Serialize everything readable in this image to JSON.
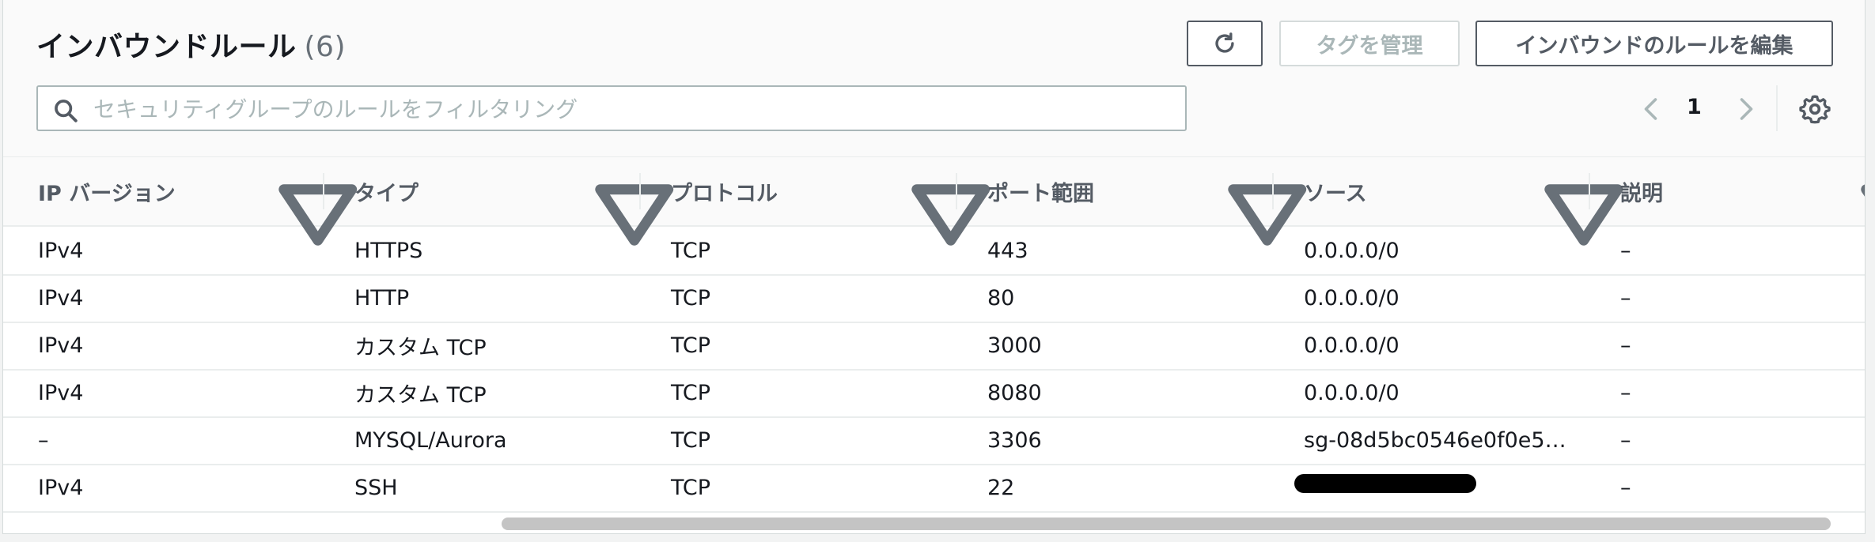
{
  "header": {
    "title": "インバウンドルール",
    "count": "(6)",
    "buttons": {
      "manage_tags": "タグを管理",
      "edit_inbound": "インバウンドのルールを編集"
    }
  },
  "search": {
    "placeholder": "セキュリティグループのルールをフィルタリング"
  },
  "pagination": {
    "page": "1"
  },
  "table": {
    "columns": [
      "IP バージョン",
      "タイプ",
      "プロトコル",
      "ポート範囲",
      "ソース",
      "説明"
    ],
    "rows": [
      [
        "IPv4",
        "HTTPS",
        "TCP",
        "443",
        "0.0.0.0/0",
        "–"
      ],
      [
        "IPv4",
        "HTTP",
        "TCP",
        "80",
        "0.0.0.0/0",
        "–"
      ],
      [
        "IPv4",
        "カスタム TCP",
        "TCP",
        "3000",
        "0.0.0.0/0",
        "–"
      ],
      [
        "IPv4",
        "カスタム TCP",
        "TCP",
        "8080",
        "0.0.0.0/0",
        "–"
      ],
      [
        "–",
        "MYSQL/Aurora",
        "TCP",
        "3306",
        "sg-08d5bc0546e0f0e5…",
        "–"
      ],
      [
        "IPv4",
        "SSH",
        "TCP",
        "22",
        "",
        "–"
      ]
    ]
  },
  "icons": [
    "refresh-icon",
    "search-icon",
    "chevron-left-icon",
    "chevron-right-icon",
    "settings-icon",
    "sort-icon"
  ],
  "colors": {
    "text": "#16191f",
    "secondary": "#545b64",
    "border": "#eaeded",
    "disabled": "#aab7b8"
  }
}
